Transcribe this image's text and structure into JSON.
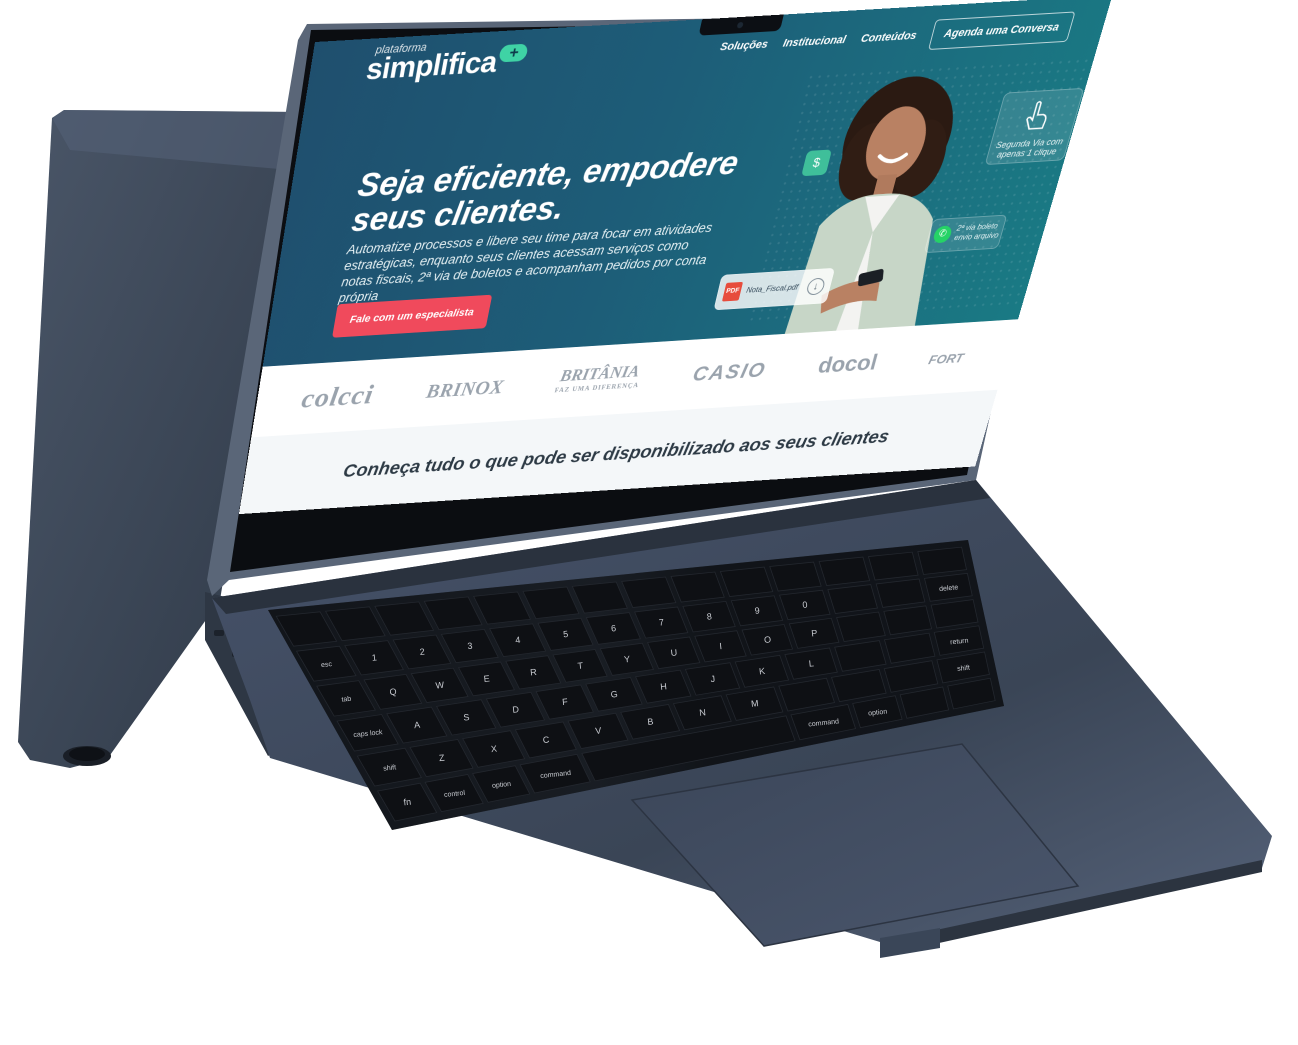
{
  "website": {
    "logo": {
      "top_text": "plataforma",
      "main_text": "simplifica",
      "plus": "+"
    },
    "nav": {
      "links": [
        "Soluções",
        "Institucional",
        "Conteúdos"
      ],
      "cta": "Agenda uma Conversa"
    },
    "hero": {
      "title": "Seja eficiente, empodere seus clientes.",
      "subtitle": "Automatize processos e libere seu time para focar em atividades estratégicas, enquanto seus clientes acessam serviços como notas fiscais, 2ª via de boletos e acompanham pedidos por conta própria",
      "button": "Fale com um especialista",
      "cards": {
        "hand_label": "Segunda Via com apenas 1 clique",
        "file_badge": "PDF",
        "file_name": "Nota_Fiscal.pdf",
        "chat_label": "2ª via boleto envio arquivo"
      }
    },
    "brands": [
      "colcci",
      "BRINOX",
      "BRITÂNIA",
      "CASIO",
      "docol",
      "FORT"
    ],
    "brand_taglines": {
      "britania": "FAZ UMA DIFERENÇA"
    },
    "section_title": "Conheça tudo o que pode ser disponibilizado aos seus clientes"
  },
  "keyboard": {
    "keys": [
      "esc",
      "delete",
      "return",
      "shift",
      "tab",
      "caps lock",
      "shift",
      "fn",
      "control",
      "option",
      "command",
      "command",
      "option"
    ],
    "digits": [
      "1",
      "2",
      "3",
      "4",
      "5",
      "6",
      "7",
      "8",
      "9",
      "0"
    ],
    "letters_row1": [
      "Q",
      "W",
      "E",
      "R",
      "T",
      "Y",
      "U",
      "I",
      "O",
      "P"
    ],
    "letters_row2": [
      "A",
      "S",
      "D",
      "F",
      "G",
      "H",
      "J",
      "K",
      "L"
    ],
    "letters_row3": [
      "Z",
      "X",
      "C",
      "V",
      "B",
      "N",
      "M"
    ]
  },
  "colors": {
    "hero_start": "#1f4f6e",
    "hero_end": "#1a7a84",
    "accent_button": "#f04a5c",
    "logo_plus": "#3fd3a5",
    "laptop_body": "#3e4a5a",
    "keys": "#0d0f13"
  }
}
